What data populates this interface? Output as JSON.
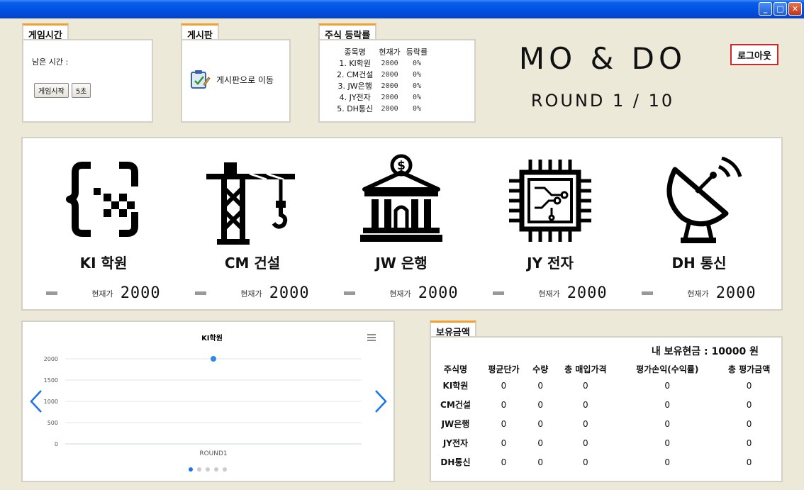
{
  "window": {
    "min": "_",
    "max": "□",
    "close": "✕"
  },
  "game_time": {
    "tab": "게임시간",
    "remaining_label": "남은 시간 :",
    "start_button": "게임시작",
    "time_button": "5초"
  },
  "board": {
    "tab": "게시판",
    "link": "게시판으로 이동"
  },
  "ranking": {
    "tab": "주식 등락률",
    "headers": [
      "종목명",
      "현재가",
      "등락률"
    ],
    "rows": [
      {
        "name": "1. KI학원",
        "price": "2000",
        "change": "0%"
      },
      {
        "name": "2. CM건설",
        "price": "2000",
        "change": "0%"
      },
      {
        "name": "3. JW은행",
        "price": "2000",
        "change": "0%"
      },
      {
        "name": "4. JY전자",
        "price": "2000",
        "change": "0%"
      },
      {
        "name": "5. DH통신",
        "price": "2000",
        "change": "0%"
      }
    ]
  },
  "brand": {
    "title": "MO & DO",
    "round": "ROUND 1 / 10"
  },
  "logout": "로그아웃",
  "companies": [
    {
      "name": "KI 학원",
      "price_label": "현재가",
      "price": "2000",
      "icon": "code-block-icon"
    },
    {
      "name": "CM 건설",
      "price_label": "현재가",
      "price": "2000",
      "icon": "crane-icon"
    },
    {
      "name": "JW 은행",
      "price_label": "현재가",
      "price": "2000",
      "icon": "bank-icon"
    },
    {
      "name": "JY 전자",
      "price_label": "현재가",
      "price": "2000",
      "icon": "chip-icon"
    },
    {
      "name": "DH 통신",
      "price_label": "현재가",
      "price": "2000",
      "icon": "satellite-dish-icon"
    }
  ],
  "chart_data": {
    "type": "line",
    "title": "KI학원",
    "categories": [
      "ROUND1"
    ],
    "series": [
      {
        "values": [
          2000
        ]
      }
    ],
    "yticks": [
      0,
      500,
      1000,
      1500,
      2000
    ],
    "ylim": [
      0,
      2000
    ],
    "grid": true,
    "color": "#2b8be6"
  },
  "holdings": {
    "tab": "보유금액",
    "cash": "내 보유현금 : 10000 원",
    "headers": [
      "주식명",
      "평균단가",
      "수량",
      "총 매입가격",
      "평가손익(수익률)",
      "총 평가금액"
    ],
    "rows": [
      [
        "KI학원",
        "0",
        "0",
        "0",
        "0",
        "0"
      ],
      [
        "CM건설",
        "0",
        "0",
        "0",
        "0",
        "0"
      ],
      [
        "JW은행",
        "0",
        "0",
        "0",
        "0",
        "0"
      ],
      [
        "JY전자",
        "0",
        "0",
        "0",
        "0",
        "0"
      ],
      [
        "DH통신",
        "0",
        "0",
        "0",
        "0",
        "0"
      ]
    ]
  }
}
